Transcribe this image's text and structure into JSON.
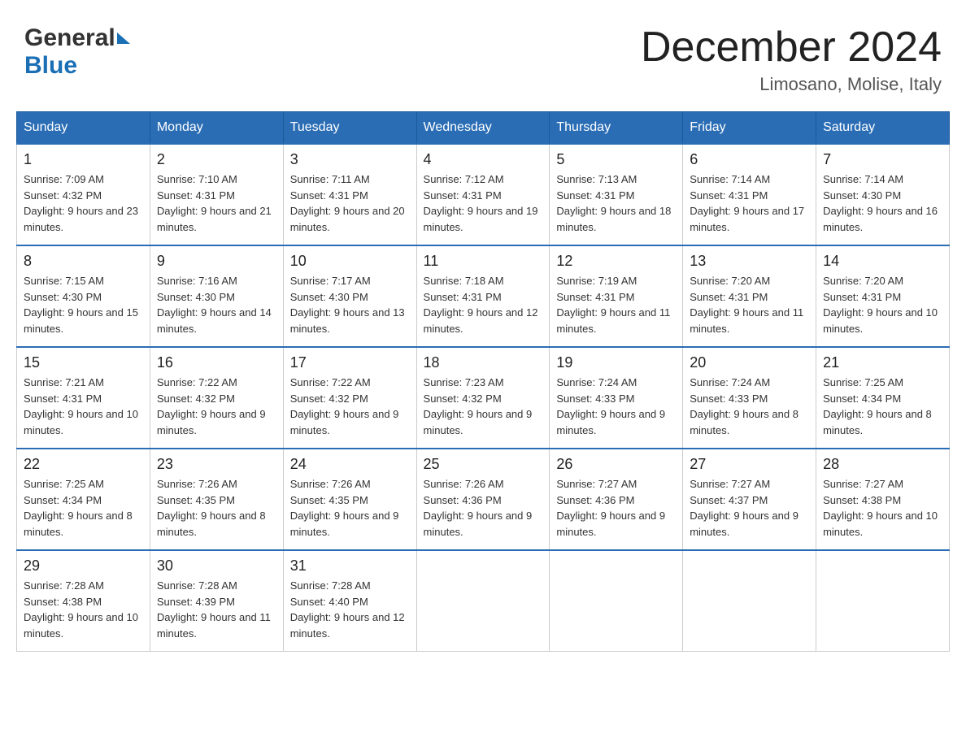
{
  "header": {
    "logo_general": "General",
    "logo_blue": "Blue",
    "month_title": "December 2024",
    "subtitle": "Limosano, Molise, Italy"
  },
  "days_of_week": [
    "Sunday",
    "Monday",
    "Tuesday",
    "Wednesday",
    "Thursday",
    "Friday",
    "Saturday"
  ],
  "weeks": [
    [
      {
        "day": "1",
        "sunrise": "7:09 AM",
        "sunset": "4:32 PM",
        "daylight": "9 hours and 23 minutes."
      },
      {
        "day": "2",
        "sunrise": "7:10 AM",
        "sunset": "4:31 PM",
        "daylight": "9 hours and 21 minutes."
      },
      {
        "day": "3",
        "sunrise": "7:11 AM",
        "sunset": "4:31 PM",
        "daylight": "9 hours and 20 minutes."
      },
      {
        "day": "4",
        "sunrise": "7:12 AM",
        "sunset": "4:31 PM",
        "daylight": "9 hours and 19 minutes."
      },
      {
        "day": "5",
        "sunrise": "7:13 AM",
        "sunset": "4:31 PM",
        "daylight": "9 hours and 18 minutes."
      },
      {
        "day": "6",
        "sunrise": "7:14 AM",
        "sunset": "4:31 PM",
        "daylight": "9 hours and 17 minutes."
      },
      {
        "day": "7",
        "sunrise": "7:14 AM",
        "sunset": "4:30 PM",
        "daylight": "9 hours and 16 minutes."
      }
    ],
    [
      {
        "day": "8",
        "sunrise": "7:15 AM",
        "sunset": "4:30 PM",
        "daylight": "9 hours and 15 minutes."
      },
      {
        "day": "9",
        "sunrise": "7:16 AM",
        "sunset": "4:30 PM",
        "daylight": "9 hours and 14 minutes."
      },
      {
        "day": "10",
        "sunrise": "7:17 AM",
        "sunset": "4:30 PM",
        "daylight": "9 hours and 13 minutes."
      },
      {
        "day": "11",
        "sunrise": "7:18 AM",
        "sunset": "4:31 PM",
        "daylight": "9 hours and 12 minutes."
      },
      {
        "day": "12",
        "sunrise": "7:19 AM",
        "sunset": "4:31 PM",
        "daylight": "9 hours and 11 minutes."
      },
      {
        "day": "13",
        "sunrise": "7:20 AM",
        "sunset": "4:31 PM",
        "daylight": "9 hours and 11 minutes."
      },
      {
        "day": "14",
        "sunrise": "7:20 AM",
        "sunset": "4:31 PM",
        "daylight": "9 hours and 10 minutes."
      }
    ],
    [
      {
        "day": "15",
        "sunrise": "7:21 AM",
        "sunset": "4:31 PM",
        "daylight": "9 hours and 10 minutes."
      },
      {
        "day": "16",
        "sunrise": "7:22 AM",
        "sunset": "4:32 PM",
        "daylight": "9 hours and 9 minutes."
      },
      {
        "day": "17",
        "sunrise": "7:22 AM",
        "sunset": "4:32 PM",
        "daylight": "9 hours and 9 minutes."
      },
      {
        "day": "18",
        "sunrise": "7:23 AM",
        "sunset": "4:32 PM",
        "daylight": "9 hours and 9 minutes."
      },
      {
        "day": "19",
        "sunrise": "7:24 AM",
        "sunset": "4:33 PM",
        "daylight": "9 hours and 9 minutes."
      },
      {
        "day": "20",
        "sunrise": "7:24 AM",
        "sunset": "4:33 PM",
        "daylight": "9 hours and 8 minutes."
      },
      {
        "day": "21",
        "sunrise": "7:25 AM",
        "sunset": "4:34 PM",
        "daylight": "9 hours and 8 minutes."
      }
    ],
    [
      {
        "day": "22",
        "sunrise": "7:25 AM",
        "sunset": "4:34 PM",
        "daylight": "9 hours and 8 minutes."
      },
      {
        "day": "23",
        "sunrise": "7:26 AM",
        "sunset": "4:35 PM",
        "daylight": "9 hours and 8 minutes."
      },
      {
        "day": "24",
        "sunrise": "7:26 AM",
        "sunset": "4:35 PM",
        "daylight": "9 hours and 9 minutes."
      },
      {
        "day": "25",
        "sunrise": "7:26 AM",
        "sunset": "4:36 PM",
        "daylight": "9 hours and 9 minutes."
      },
      {
        "day": "26",
        "sunrise": "7:27 AM",
        "sunset": "4:36 PM",
        "daylight": "9 hours and 9 minutes."
      },
      {
        "day": "27",
        "sunrise": "7:27 AM",
        "sunset": "4:37 PM",
        "daylight": "9 hours and 9 minutes."
      },
      {
        "day": "28",
        "sunrise": "7:27 AM",
        "sunset": "4:38 PM",
        "daylight": "9 hours and 10 minutes."
      }
    ],
    [
      {
        "day": "29",
        "sunrise": "7:28 AM",
        "sunset": "4:38 PM",
        "daylight": "9 hours and 10 minutes."
      },
      {
        "day": "30",
        "sunrise": "7:28 AM",
        "sunset": "4:39 PM",
        "daylight": "9 hours and 11 minutes."
      },
      {
        "day": "31",
        "sunrise": "7:28 AM",
        "sunset": "4:40 PM",
        "daylight": "9 hours and 12 minutes."
      },
      null,
      null,
      null,
      null
    ]
  ],
  "labels": {
    "sunrise": "Sunrise:",
    "sunset": "Sunset:",
    "daylight": "Daylight:"
  }
}
